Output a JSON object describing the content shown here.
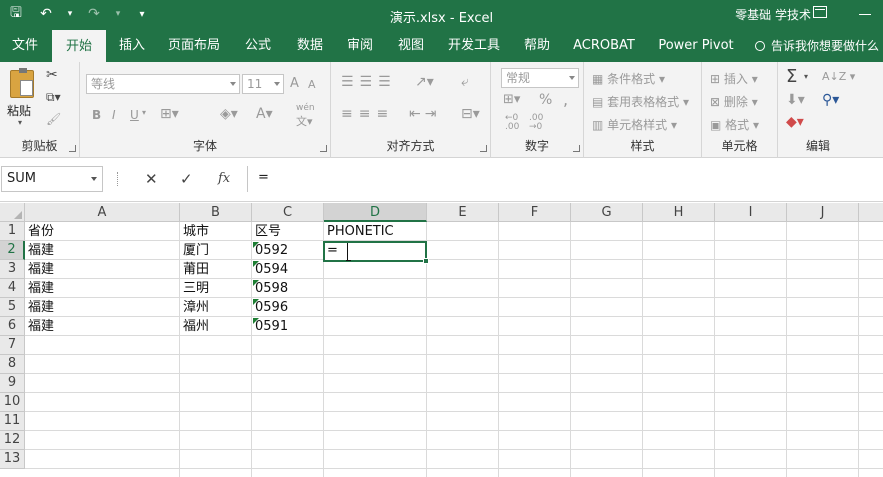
{
  "titlebar": {
    "title": "演示.xlsx  -  Excel",
    "user": "零基础 学技术",
    "qat": {
      "save": "🖫",
      "undo": "↶",
      "redo": "↷",
      "more": "▾"
    }
  },
  "tabs": [
    {
      "label": "文件"
    },
    {
      "label": "开始"
    },
    {
      "label": "插入"
    },
    {
      "label": "页面布局"
    },
    {
      "label": "公式"
    },
    {
      "label": "数据"
    },
    {
      "label": "审阅"
    },
    {
      "label": "视图"
    },
    {
      "label": "开发工具"
    },
    {
      "label": "帮助"
    },
    {
      "label": "ACROBAT"
    },
    {
      "label": "Power Pivot"
    }
  ],
  "tell_me": "告诉我你想要做什么",
  "ribbon": {
    "clipboard": {
      "label": "剪贴板",
      "paste": "粘贴"
    },
    "font": {
      "label": "字体",
      "font_name": "等线",
      "font_size": "11",
      "bold": "B",
      "italic": "I",
      "underline": "U",
      "font_grow": "A",
      "font_shrink": "A",
      "phonetic": "wén"
    },
    "alignment": {
      "label": "对齐方式"
    },
    "number": {
      "label": "数字",
      "format": "常规",
      "percent": "%",
      "comma": ","
    },
    "styles": {
      "label": "样式",
      "conditional": "条件格式",
      "table": "套用表格格式",
      "cell": "单元格样式"
    },
    "cells": {
      "label": "单元格",
      "insert": "插入",
      "delete": "删除",
      "format": "格式"
    },
    "editing": {
      "label": "编辑",
      "sum": "Σ",
      "sort": "A↓Z"
    }
  },
  "formula_bar": {
    "name_box": "SUM",
    "cancel": "✕",
    "enter": "✓",
    "fx": "fx",
    "content": "="
  },
  "sheet": {
    "columns": [
      "A",
      "B",
      "C",
      "D",
      "E",
      "F",
      "G",
      "H",
      "I",
      "J"
    ],
    "selected_column": "D",
    "rows": [
      "1",
      "2",
      "3",
      "4",
      "5",
      "6",
      "7",
      "8",
      "9",
      "10",
      "11",
      "12",
      "13"
    ],
    "selected_row": "2",
    "cells": {
      "A1": "省份",
      "B1": "城市",
      "C1": "区号",
      "D1": "PHONETIC",
      "A2": "福建",
      "B2": "厦门",
      "C2": "0592",
      "D2": "=",
      "A3": "福建",
      "B3": "莆田",
      "C3": "0594",
      "A4": "福建",
      "B4": "三明",
      "C4": "0598",
      "A5": "福建",
      "B5": "漳州",
      "C5": "0596",
      "A6": "福建",
      "B6": "福州",
      "C6": "0591"
    }
  },
  "colors": {
    "accent": "#217346",
    "ribbon_bg": "#f3f3f3",
    "text_marker": "#1e7e34"
  }
}
